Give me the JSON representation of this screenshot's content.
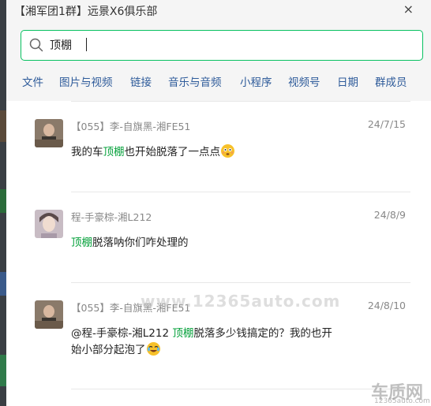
{
  "window": {
    "title": "【湘军团1群】远景X6俱乐部",
    "close_label": "×"
  },
  "search": {
    "value": "顶棚",
    "icon": "search-icon"
  },
  "tabs": [
    {
      "label": "文件"
    },
    {
      "label": "图片与视频"
    },
    {
      "label": "链接"
    },
    {
      "label": "音乐与音频"
    },
    {
      "label": "小程序"
    },
    {
      "label": "视频号"
    },
    {
      "label": "日期"
    },
    {
      "label": "群成员"
    }
  ],
  "messages": [
    {
      "sender": "【055】李-自旗黑-湘FE51",
      "date": "24/7/15",
      "text_before": "我的车",
      "highlight": "顶棚",
      "text_after": "也开始脱落了一点点",
      "emoji": "flushed-face-emoji"
    },
    {
      "sender": "程-手豪棕-湘L212",
      "date": "24/8/9",
      "text_before": "",
      "highlight": "顶棚",
      "text_after": "脱落呐你们咋处理的"
    },
    {
      "sender": "【055】李-自旗黑-湘FE51",
      "date": "24/8/10",
      "text_before": "@程-手豪棕-湘L212 ",
      "highlight": "顶棚",
      "text_after": "脱落多少钱搞定的？我的也开",
      "line2": "始小部分起泡了",
      "emoji": "laughing-tears-emoji"
    }
  ],
  "watermark": {
    "text": "www.12365auto.com",
    "logo_text": "车质网",
    "logo_sub": "12365auto.com"
  },
  "colors": {
    "accent": "#07c160",
    "highlight": "#07a13c",
    "tab_text": "#2e5b9a"
  }
}
